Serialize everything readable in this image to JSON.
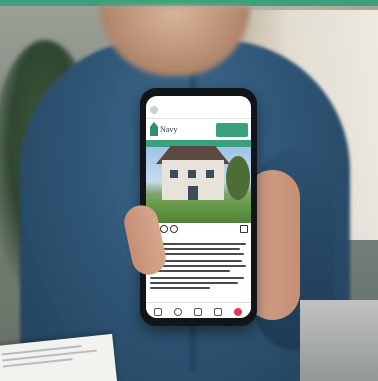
{
  "colors": {
    "accent_band": "#3aa17a",
    "shirt": "#2f5676",
    "phone_frame": "#111418",
    "notification_badge": "#e03a57"
  },
  "post": {
    "logo_text": "Navy",
    "photo_tag": "",
    "caption_heading": ""
  }
}
